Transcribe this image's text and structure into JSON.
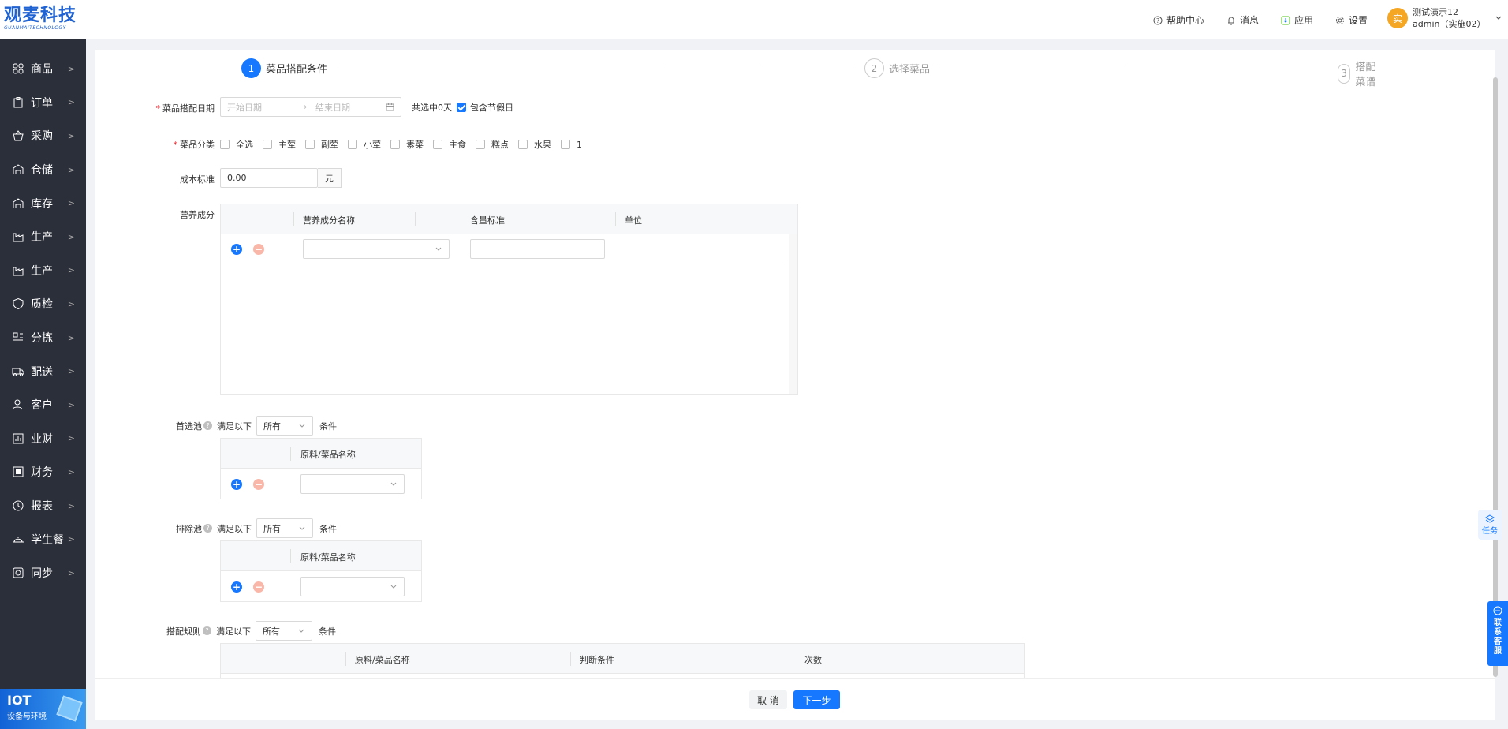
{
  "brand": {
    "logo_main": "观麦科技",
    "logo_sub": "GUANMAITECHNOLOGY"
  },
  "sidebar": {
    "items": [
      {
        "label": "商品",
        "icon": "grid-icon"
      },
      {
        "label": "订单",
        "icon": "clipboard-icon"
      },
      {
        "label": "采购",
        "icon": "basket-icon"
      },
      {
        "label": "仓储",
        "icon": "warehouse-icon"
      },
      {
        "label": "库存",
        "icon": "warehouse-icon"
      },
      {
        "label": "生产",
        "icon": "factory-icon"
      },
      {
        "label": "生产",
        "icon": "factory-icon"
      },
      {
        "label": "质检",
        "icon": "shield-icon"
      },
      {
        "label": "分拣",
        "icon": "sort-icon"
      },
      {
        "label": "配送",
        "icon": "truck-icon"
      },
      {
        "label": "客户",
        "icon": "user-icon"
      },
      {
        "label": "业财",
        "icon": "chart-icon"
      },
      {
        "label": "财务",
        "icon": "ledger-icon"
      },
      {
        "label": "报表",
        "icon": "clock-icon"
      },
      {
        "label": "学生餐",
        "icon": "dish-icon"
      },
      {
        "label": "同步",
        "icon": "sync-icon"
      }
    ],
    "arrow": ">"
  },
  "iot": {
    "title": "IOT",
    "subtitle": "设备与环境"
  },
  "topbar": {
    "help": "帮助中心",
    "messages": "消息",
    "apps": "应用",
    "settings": "设置",
    "user_name": "测试演示12",
    "user_account": "admin（实施02）",
    "avatar_text": "实"
  },
  "steps": [
    {
      "num": "1",
      "label": "菜品搭配条件",
      "state": "active"
    },
    {
      "num": "2",
      "label": "选择菜品",
      "state": "pending"
    },
    {
      "num": "3",
      "label": "搭配菜谱",
      "state": "pending"
    }
  ],
  "form": {
    "date_label": "菜品搭配日期",
    "date_start_placeholder": "开始日期",
    "date_end_placeholder": "结束日期",
    "date_arrow": "→",
    "selected_days": "共选中0天",
    "include_holiday": "包含节假日",
    "include_holiday_checked": true,
    "category_label": "菜品分类",
    "categories": [
      "全选",
      "主荤",
      "副荤",
      "小荤",
      "素菜",
      "主食",
      "糕点",
      "水果",
      "1"
    ],
    "cost_label": "成本标准",
    "cost_value": "0.00",
    "cost_unit": "元",
    "nutrition_label": "营养成分",
    "nutrition_headers": [
      "营养成分名称",
      "含量标准",
      "单位"
    ],
    "preferred_label": "首选池",
    "exclude_label": "排除池",
    "rules_label": "搭配规则",
    "satisfy_prefix": "满足以下",
    "satisfy_select": "所有",
    "satisfy_suffix": "条件",
    "pool_header": "原料/菜品名称",
    "rule_headers": [
      "原料/菜品名称",
      "判断条件",
      "次数"
    ]
  },
  "footer": {
    "cancel": "取 消",
    "next": "下一步"
  },
  "floats": {
    "task": "任务",
    "cs_chars": [
      "联",
      "系",
      "客",
      "服"
    ]
  },
  "colors": {
    "primary": "#1677ff",
    "sidebar_bg": "#2b2f3a",
    "required": "#f5222d"
  }
}
